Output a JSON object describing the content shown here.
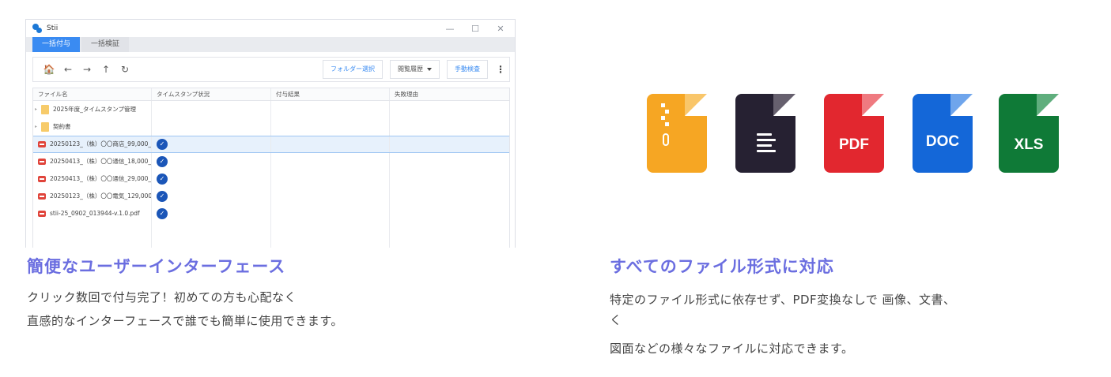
{
  "app": {
    "title": "Stii",
    "window_controls": {
      "minimize": "—",
      "maximize": "☐",
      "close": "✕"
    },
    "tabs": [
      {
        "label": "一括付与",
        "active": true
      },
      {
        "label": "一括検証",
        "active": false
      }
    ],
    "toolbar": {
      "nav": {
        "home": "🏠",
        "back": "←",
        "forward": "→",
        "up": "↑",
        "refresh": "↻"
      },
      "folder_select": "フォルダー選択",
      "history": "閲覧履歴",
      "manual_verify": "手動検査",
      "more": "⋮"
    },
    "table": {
      "columns": [
        "ファイル名",
        "タイムスタンプ状況",
        "付与結果",
        "失敗理由"
      ],
      "rows": [
        {
          "type": "folder",
          "name": "2025年度_タイムスタンプ管理",
          "status": ""
        },
        {
          "type": "folder",
          "name": "契約書",
          "status": ""
        },
        {
          "type": "pdf",
          "name": "20250123_（株）〇〇商店_99,000_",
          "status": "✓",
          "selected": true
        },
        {
          "type": "pdf",
          "name": "20250413_（株）〇〇通信_18,000_",
          "status": "✓"
        },
        {
          "type": "pdf",
          "name": "20250413_（株）〇〇通信_29,000_",
          "status": "✓"
        },
        {
          "type": "pdf",
          "name": "20250123_（株）〇〇電気_129,000_",
          "status": "✓"
        },
        {
          "type": "pdf",
          "name": "stii-25_0902_013944-v.1.0.pdf",
          "status": "✓"
        }
      ]
    }
  },
  "features": [
    {
      "heading": "簡便なユーザーインターフェース",
      "lines": [
        "クリック数回で付与完了！初めての方も心配なく",
        "直感的なインターフェースで誰でも簡単に使用できます。"
      ]
    },
    {
      "heading": "すべてのファイル形式に対応",
      "lines": [
        "特定のファイル形式に依存せず、PDF変換なしで 画像、文書、",
        "く",
        "図面などの様々なファイルに対応できます。"
      ]
    }
  ],
  "file_icons": [
    {
      "kind": "zip-icon",
      "label": "",
      "color": "#f6a623"
    },
    {
      "kind": "text-icon",
      "label": "",
      "color": "#262132"
    },
    {
      "kind": "pdf-icon",
      "label": "PDF",
      "color": "#e2272f"
    },
    {
      "kind": "doc-icon",
      "label": "DOC",
      "color": "#1467d8"
    },
    {
      "kind": "xls-icon",
      "label": "XLS",
      "color": "#0f7a37"
    }
  ]
}
